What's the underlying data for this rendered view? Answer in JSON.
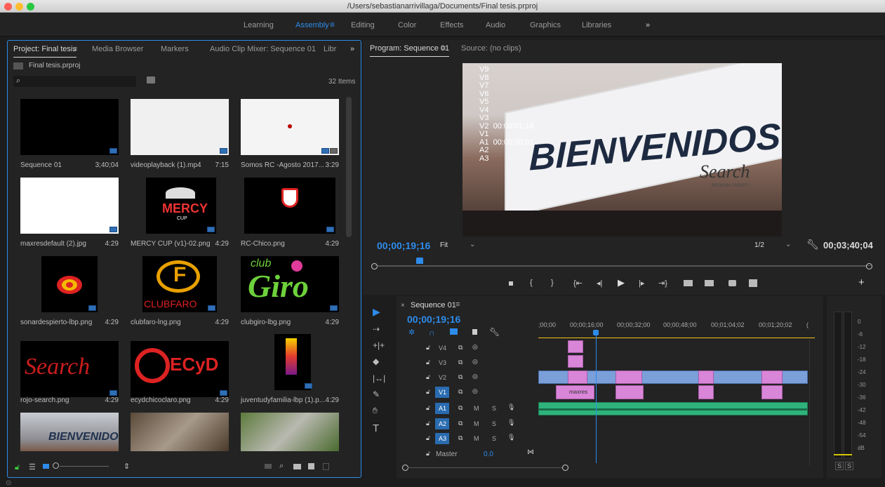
{
  "window": {
    "path": "/Users/sebastianarrivillaga/Documents/Final tesis.prproj"
  },
  "workspaces": [
    "Learning",
    "Assembly",
    "Editing",
    "Color",
    "Effects",
    "Audio",
    "Graphics",
    "Libraries"
  ],
  "project": {
    "tabs": [
      "Project: Final tesis",
      "Media Browser",
      "Markers",
      "Audio Clip Mixer: Sequence 01",
      "Libr"
    ],
    "file": "Final tesis.prproj",
    "search_placeholder": "",
    "items_count": "32 Items",
    "clips": [
      {
        "name": "Sequence 01",
        "duration": "3;40;04"
      },
      {
        "name": "videoplayback (1).mp4",
        "duration": "7:15"
      },
      {
        "name": "Somos RC -Agosto 2017...",
        "duration": "3:29"
      },
      {
        "name": "maxresdefault (2).jpg",
        "duration": "4:29"
      },
      {
        "name": "MERCY CUP (v1)-02.png",
        "duration": "4:29"
      },
      {
        "name": "RC-Chico.png",
        "duration": "4:29"
      },
      {
        "name": "sonardespierto-lbp.png",
        "duration": "4:29"
      },
      {
        "name": "clubfaro-lng.png",
        "duration": "4:29"
      },
      {
        "name": "clubgiro-lbg.png",
        "duration": "4:29"
      },
      {
        "name": "rojo-search.png",
        "duration": "4:29"
      },
      {
        "name": "ecydchicoclaro.png",
        "duration": "4:29"
      },
      {
        "name": "juventudyfamilia-lbp (1).p...",
        "duration": "4:29"
      }
    ],
    "thumb_text": {
      "mercy": "MERCY",
      "mercy_sub": "CUP",
      "faro": "CLUBFARO",
      "giro_club": "club",
      "giro": "Giro",
      "search": "Search",
      "ecyd": "ECyD",
      "bienvenidos": "BIENVENIDO"
    }
  },
  "program": {
    "tabs": [
      "Program: Sequence 01",
      "Source: (no clips)"
    ],
    "overlay": [
      {
        "track": "V9",
        "tc": ""
      },
      {
        "track": "V8",
        "tc": ""
      },
      {
        "track": "V7",
        "tc": ""
      },
      {
        "track": "V6",
        "tc": ""
      },
      {
        "track": "V5",
        "tc": ""
      },
      {
        "track": "V4",
        "tc": ""
      },
      {
        "track": "V3",
        "tc": ""
      },
      {
        "track": "V2",
        "tc": "00:00:01:18"
      },
      {
        "track": "V1",
        "tc": ""
      },
      {
        "track": "A1",
        "tc": "00:00:30:01"
      },
      {
        "track": "A2",
        "tc": ""
      },
      {
        "track": "A3",
        "tc": ""
      }
    ],
    "banner_text": "BIENVENIDOS",
    "banner_sub": "Search",
    "banner_sub2": "REGNUM CHRISTI",
    "timecode": "00;00;19;16",
    "fit": "Fit",
    "resolution": "1/2",
    "duration": "00;03;40;04",
    "playhead_fraction": 0.09
  },
  "timeline": {
    "tab": "Sequence 01",
    "timecode": "00;00;19;16",
    "ruler": [
      ";00;00",
      "00;00;16;00",
      "00;00;32;00",
      "00;00;48;00",
      "00;01;04;02",
      "00;01;20;02",
      "("
    ],
    "tracks": [
      {
        "id": "V4",
        "type": "video"
      },
      {
        "id": "V3",
        "type": "video"
      },
      {
        "id": "V2",
        "type": "video"
      },
      {
        "id": "V1",
        "type": "video"
      },
      {
        "id": "A1",
        "type": "audio"
      },
      {
        "id": "A2",
        "type": "audio"
      },
      {
        "id": "A3",
        "type": "audio"
      }
    ],
    "master_label": "Master",
    "master_value": "0.0",
    "clip_label": "maxres",
    "mute": "M",
    "solo": "S"
  },
  "meters": {
    "scale": [
      "0",
      "-6",
      "-12",
      "-18",
      "-24",
      "-30",
      "-36",
      "-42",
      "-48",
      "-54",
      "dB"
    ],
    "solo_left": "S",
    "solo_right": "S"
  },
  "colors": {
    "accent": "#2d8ceb",
    "panel": "#232323",
    "video_clip": "#d986d9",
    "audio_clip": "#2fb37d"
  }
}
